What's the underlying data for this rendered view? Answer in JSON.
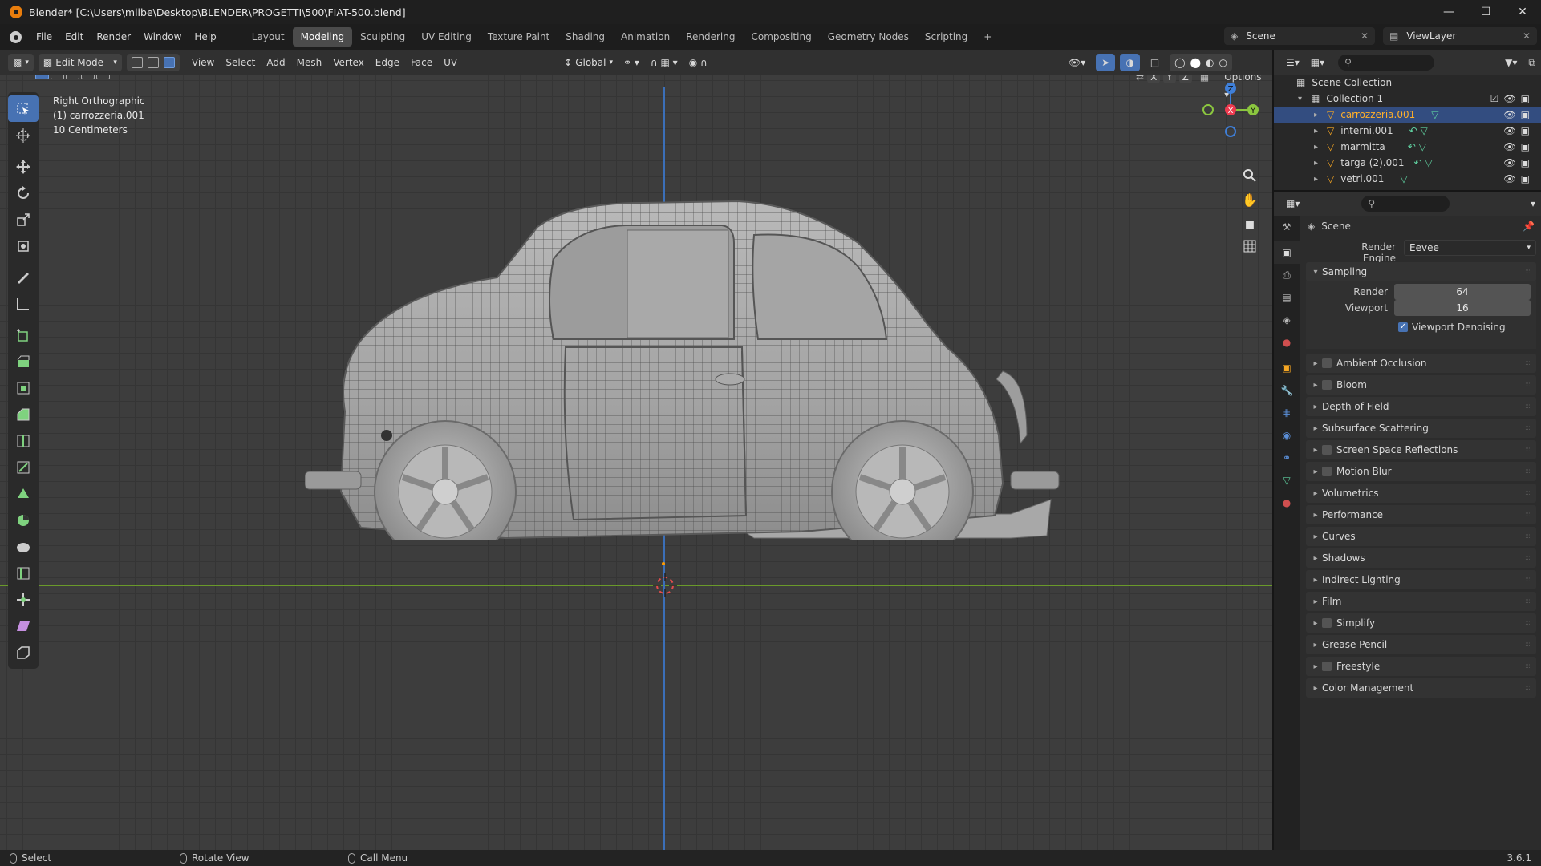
{
  "app": {
    "title": "Blender* [C:\\Users\\mlibe\\Desktop\\BLENDER\\PROGETTI\\500\\FIAT-500.blend]",
    "version": "3.6.1"
  },
  "menu": [
    "File",
    "Edit",
    "Render",
    "Window",
    "Help"
  ],
  "workspaces": [
    "Layout",
    "Modeling",
    "Sculpting",
    "UV Editing",
    "Texture Paint",
    "Shading",
    "Animation",
    "Rendering",
    "Compositing",
    "Geometry Nodes",
    "Scripting",
    "+"
  ],
  "active_workspace": "Modeling",
  "scene_name": "Scene",
  "view_layer": "ViewLayer",
  "viewport_header": {
    "mode": "Edit Mode",
    "menus": [
      "View",
      "Select",
      "Add",
      "Mesh",
      "Vertex",
      "Edge",
      "Face",
      "UV"
    ],
    "orientation": "Global",
    "options_label": "Options",
    "axes": [
      "X",
      "Y",
      "Z"
    ]
  },
  "viewport_info": {
    "view": "Right Orthographic",
    "object": "(1) carrozzeria.001",
    "scale": "10 Centimeters"
  },
  "gizmo": {
    "z": "Z",
    "y": "Y",
    "x": "X"
  },
  "outliner": {
    "root": "Scene Collection",
    "collection": "Collection 1",
    "objects": [
      {
        "name": "carrozzeria.001",
        "selected": true
      },
      {
        "name": "interni.001",
        "selected": false
      },
      {
        "name": "marmitta",
        "selected": false
      },
      {
        "name": "targa (2).001",
        "selected": false
      },
      {
        "name": "vetri.001",
        "selected": false
      }
    ]
  },
  "properties": {
    "context": "Scene",
    "render_engine_label": "Render Engine",
    "render_engine": "Eevee",
    "sampling": {
      "title": "Sampling",
      "render_label": "Render",
      "render_value": "64",
      "viewport_label": "Viewport",
      "viewport_value": "16",
      "denoise_label": "Viewport Denoising"
    },
    "panels": [
      {
        "label": "Ambient Occlusion",
        "checkbox": true
      },
      {
        "label": "Bloom",
        "checkbox": true
      },
      {
        "label": "Depth of Field",
        "checkbox": false
      },
      {
        "label": "Subsurface Scattering",
        "checkbox": false
      },
      {
        "label": "Screen Space Reflections",
        "checkbox": true
      },
      {
        "label": "Motion Blur",
        "checkbox": true
      },
      {
        "label": "Volumetrics",
        "checkbox": false
      },
      {
        "label": "Performance",
        "checkbox": false
      },
      {
        "label": "Curves",
        "checkbox": false
      },
      {
        "label": "Shadows",
        "checkbox": false
      },
      {
        "label": "Indirect Lighting",
        "checkbox": false
      },
      {
        "label": "Film",
        "checkbox": false
      },
      {
        "label": "Simplify",
        "checkbox": true
      },
      {
        "label": "Grease Pencil",
        "checkbox": false
      },
      {
        "label": "Freestyle",
        "checkbox": true
      },
      {
        "label": "Color Management",
        "checkbox": false
      }
    ]
  },
  "status": {
    "select": "Select",
    "rotate": "Rotate View",
    "menu": "Call Menu"
  },
  "colors": {
    "accent": "#4772b3",
    "active_object": "#ffaf29",
    "x_axis": "#ee3b4f",
    "y_axis": "#8bc63f",
    "z_axis": "#3f7fd8"
  }
}
